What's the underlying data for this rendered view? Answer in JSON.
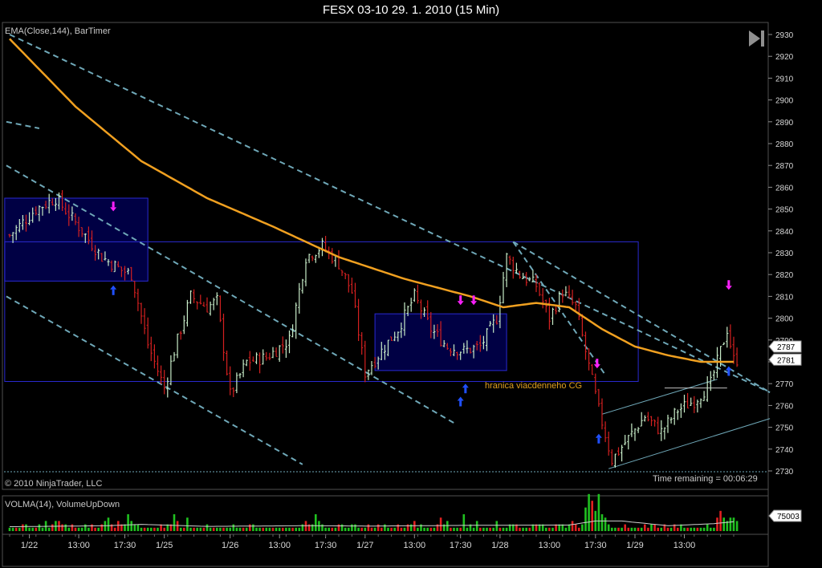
{
  "window": {
    "title": "FESX 03-10  29. 1. 2010 (15 Min)"
  },
  "price_panel": {
    "indicator_label": "EMA(Close,144), BarTimer",
    "copyright": "© 2010 NinjaTrader, LLC",
    "time_remaining": "Time remaining = 00:06:29",
    "annotation": "hranica viacdenneho CG",
    "last_price_flags": [
      "2787",
      "2781"
    ]
  },
  "volume_panel": {
    "indicator_label": "VOLMA(14), VolumeUpDown",
    "flag_value": "75003"
  },
  "colors": {
    "background": "#000000",
    "up_bar": "#c8ecc8",
    "down_bar": "#d42020",
    "ema": "#f0a020",
    "channel": "#6fa8b8",
    "box_fill": "#000050",
    "box_border": "#2a2ad0",
    "buy_arrow": "#2050ff",
    "sell_arrow": "#ff20ff",
    "volume_up": "#20c020",
    "volume_down": "#e02020",
    "annotation": "#e0a020"
  },
  "chart_data": {
    "type": "candlestick",
    "symbol": "FESX 03-10",
    "interval": "15 Min",
    "y_axis": {
      "ticks": [
        2930,
        2920,
        2910,
        2900,
        2890,
        2880,
        2870,
        2860,
        2850,
        2840,
        2830,
        2820,
        2810,
        2800,
        2790,
        2780,
        2770,
        2760,
        2750,
        2740,
        2730
      ],
      "range": [
        2727,
        2933
      ]
    },
    "x_axis": {
      "tick_labels": [
        "1/22",
        "13:00",
        "17:30",
        "1/25",
        "1/26",
        "13:00",
        "17:30",
        "1/27",
        "13:00",
        "17:30",
        "1/28",
        "13:00",
        "17:30",
        "1/29",
        "13:00"
      ],
      "tick_bar_index": [
        6,
        21,
        35,
        47,
        67,
        82,
        96,
        108,
        123,
        137,
        149,
        164,
        178,
        190,
        205
      ]
    },
    "close_anchors": [
      [
        0,
        2838
      ],
      [
        8,
        2850
      ],
      [
        14,
        2855
      ],
      [
        22,
        2840
      ],
      [
        28,
        2828
      ],
      [
        34,
        2822
      ],
      [
        37,
        2820
      ],
      [
        42,
        2788
      ],
      [
        47,
        2768
      ],
      [
        50,
        2785
      ],
      [
        55,
        2810
      ],
      [
        60,
        2805
      ],
      [
        63,
        2808
      ],
      [
        67,
        2765
      ],
      [
        72,
        2780
      ],
      [
        78,
        2782
      ],
      [
        85,
        2790
      ],
      [
        90,
        2828
      ],
      [
        95,
        2833
      ],
      [
        100,
        2825
      ],
      [
        104,
        2812
      ],
      [
        108,
        2775
      ],
      [
        113,
        2785
      ],
      [
        118,
        2795
      ],
      [
        123,
        2810
      ],
      [
        128,
        2795
      ],
      [
        133,
        2787
      ],
      [
        138,
        2785
      ],
      [
        143,
        2787
      ],
      [
        148,
        2800
      ],
      [
        151,
        2828
      ],
      [
        155,
        2820
      ],
      [
        160,
        2815
      ],
      [
        164,
        2800
      ],
      [
        168,
        2812
      ],
      [
        172,
        2805
      ],
      [
        176,
        2778
      ],
      [
        179,
        2758
      ],
      [
        183,
        2735
      ],
      [
        188,
        2745
      ],
      [
        193,
        2755
      ],
      [
        198,
        2748
      ],
      [
        203,
        2758
      ],
      [
        208,
        2762
      ],
      [
        213,
        2770
      ],
      [
        216,
        2785
      ],
      [
        218,
        2795
      ],
      [
        220,
        2781
      ]
    ],
    "ema_144": [
      [
        0,
        2928
      ],
      [
        20,
        2897
      ],
      [
        40,
        2872
      ],
      [
        60,
        2855
      ],
      [
        80,
        2842
      ],
      [
        100,
        2828
      ],
      [
        120,
        2818
      ],
      [
        140,
        2810
      ],
      [
        150,
        2805
      ],
      [
        160,
        2807
      ],
      [
        170,
        2805
      ],
      [
        175,
        2800
      ],
      [
        180,
        2795
      ],
      [
        190,
        2787
      ],
      [
        200,
        2783
      ],
      [
        210,
        2780
      ],
      [
        220,
        2780
      ]
    ],
    "last_prices": [
      2787,
      2781
    ],
    "volume_values": [
      1,
      1,
      1,
      1,
      2,
      2,
      1,
      1,
      1,
      2,
      1,
      3,
      1,
      2,
      3,
      3,
      2,
      2,
      1,
      2,
      1,
      1,
      1,
      2,
      1,
      2,
      1,
      1,
      2,
      3,
      4,
      2,
      1,
      3,
      2,
      2,
      5,
      3,
      2,
      2,
      1,
      1,
      1,
      1,
      1,
      1,
      2,
      1,
      2,
      2,
      5,
      3,
      1,
      1,
      4,
      1,
      1,
      1,
      1,
      1,
      2,
      1,
      1,
      1,
      1,
      1,
      1,
      1,
      2,
      1,
      1,
      1,
      1,
      2,
      2,
      1,
      1,
      1,
      1,
      1,
      1,
      1,
      1,
      1,
      1,
      1,
      1,
      1,
      1,
      2,
      3,
      2,
      2,
      5,
      3,
      2,
      1,
      1,
      1,
      1,
      2,
      2,
      1,
      1,
      2,
      2,
      1,
      1,
      1,
      2,
      1,
      1,
      2,
      1,
      2,
      1,
      1,
      1,
      2,
      1,
      1,
      2,
      2,
      3,
      1,
      2,
      1,
      1,
      1,
      1,
      2,
      4,
      2,
      3,
      1,
      1,
      1,
      1,
      5,
      1,
      2,
      1,
      3,
      1,
      1,
      1,
      1,
      1,
      3,
      1,
      1,
      1,
      2,
      2,
      2,
      1,
      1,
      1,
      1,
      2,
      2,
      2,
      2,
      1,
      1,
      1,
      2,
      2,
      2,
      1,
      2,
      3,
      2,
      1,
      2,
      7,
      11,
      9,
      6,
      11,
      5,
      4,
      2,
      1,
      1,
      1,
      1,
      2,
      1,
      1,
      1,
      1,
      1,
      2,
      1,
      2,
      2,
      1,
      1,
      2,
      1,
      1,
      2,
      1,
      2,
      1,
      1,
      1,
      1,
      1,
      1,
      1,
      2,
      1,
      1,
      4,
      6,
      4,
      3,
      4,
      4,
      3
    ],
    "volume_ma": [
      [
        0,
        1.3
      ],
      [
        30,
        1.6
      ],
      [
        40,
        2.0
      ],
      [
        60,
        1.4
      ],
      [
        90,
        1.6
      ],
      [
        110,
        1.5
      ],
      [
        140,
        1.7
      ],
      [
        170,
        1.8
      ],
      [
        178,
        3.0
      ],
      [
        186,
        3.0
      ],
      [
        200,
        1.6
      ],
      [
        214,
        2.2
      ],
      [
        220,
        2.8
      ]
    ]
  }
}
